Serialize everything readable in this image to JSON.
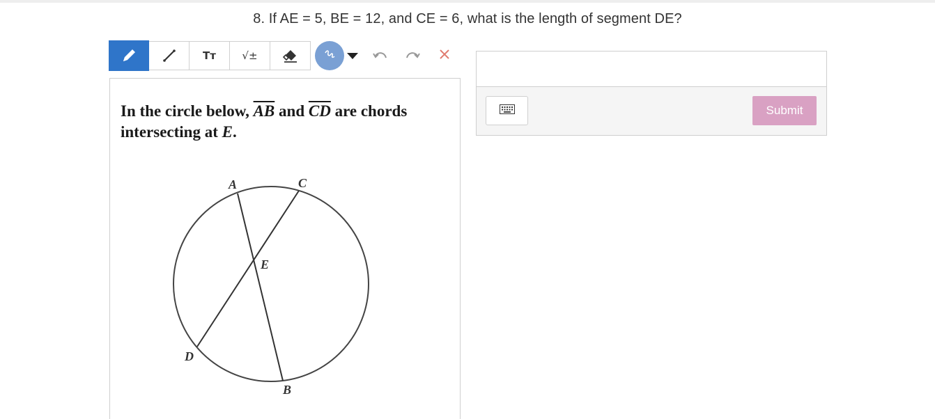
{
  "question": {
    "title": "8. If AE = 5, BE = 12, and CE = 6, what is the length of segment DE?"
  },
  "toolbar": {
    "tools": [
      {
        "name": "pencil-icon",
        "active": true
      },
      {
        "name": "line-icon",
        "active": false
      },
      {
        "name": "text-icon",
        "label": "Tт",
        "active": false
      },
      {
        "name": "math-icon",
        "label": "√±",
        "active": false
      },
      {
        "name": "eraser-icon",
        "active": false
      }
    ],
    "pen_color": "#7aa0d4",
    "undo_icon": "undo-icon",
    "redo_icon": "redo-icon",
    "clear_icon": "close-icon",
    "accent": "#2f75c9"
  },
  "problem": {
    "intro": "In the circle below,",
    "chord1": "AB",
    "and": "and",
    "chord2": "CD",
    "tail": "are chords",
    "line2": "intersecting at",
    "point": "E",
    "period": ".",
    "diagram_labels": {
      "A": "A",
      "B": "B",
      "C": "C",
      "D": "D",
      "E": "E"
    }
  },
  "answer": {
    "input_value": "",
    "keyboard_icon": "keyboard-icon",
    "submit_label": "Submit",
    "submit_color": "#d9a1c3"
  }
}
